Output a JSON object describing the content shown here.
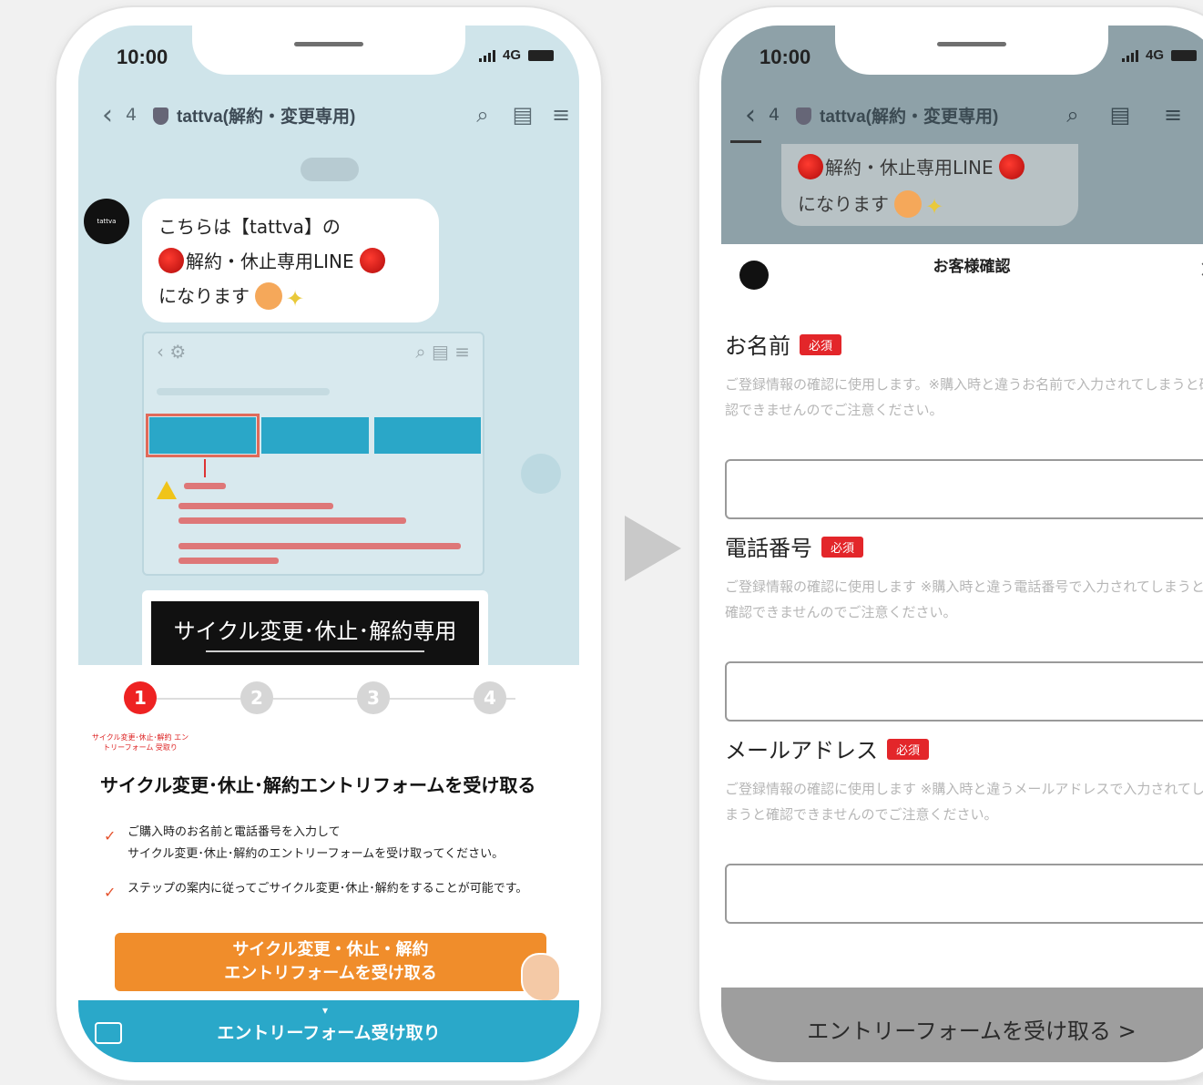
{
  "left_phone": {
    "status_time": "10:00",
    "network": "4G",
    "header": {
      "unread_count": "4",
      "title": "tattva(解約・変更専用)"
    },
    "greeting": {
      "line1": "こちらは【tattva】の",
      "line2": "解約・休止専用LINE",
      "line3": "になります"
    },
    "banner_text": "サイクル変更･休止･解約専用",
    "steps": [
      {
        "num": "1",
        "caption": "サイクル変更･休止･解約 エントリーフォーム 受取り"
      },
      {
        "num": "2",
        "caption": ""
      },
      {
        "num": "3",
        "caption": ""
      },
      {
        "num": "4",
        "caption": ""
      }
    ],
    "sheet_title": "サイクル変更･休止･解約エントリフォームを受け取る",
    "checklist": [
      {
        "line1": "ご購入時のお名前と電話番号を入力して",
        "line2": "サイクル変更･休止･解約のエントリーフォームを受け取ってください。"
      },
      {
        "line1": "ステップの案内に従ってごサイクル変更･休止･解約をすることが可能です。",
        "line2": ""
      }
    ],
    "cta": {
      "line1": "サイクル変更・休止・解約",
      "line2": "エントリフォームを受け取る"
    },
    "footer_label": "エントリーフォーム受け取り"
  },
  "right_phone": {
    "status_time": "10:00",
    "network": "4G",
    "header": {
      "unread_count": "4",
      "title": "tattva(解約・変更専用)"
    },
    "greeting": {
      "line1": "解約・休止専用LINE",
      "line2": "になります"
    },
    "modal_title": "お客様確認",
    "required_badge": "必須",
    "fields": [
      {
        "label": "お名前",
        "help": "ご登録情報の確認に使用します。※購入時と違うお名前で入力されてしまうと確認できませんのでご注意ください。"
      },
      {
        "label": "電話番号",
        "help": "ご登録情報の確認に使用します ※購入時と違う電話番号で入力されてしまうと確認できませんのでご注意ください。"
      },
      {
        "label": "メールアドレス",
        "help": "ご登録情報の確認に使用します ※購入時と違うメールアドレスで入力されてしまうと確認できませんのでご注意ください。"
      }
    ],
    "submit_label": "エントリーフォームを受け取る >"
  },
  "colors": {
    "line_blue": "#2aa8c9",
    "cta_orange": "#f08d2b",
    "required_red": "#e3262a",
    "chat_bg": "#cfe4ea"
  }
}
